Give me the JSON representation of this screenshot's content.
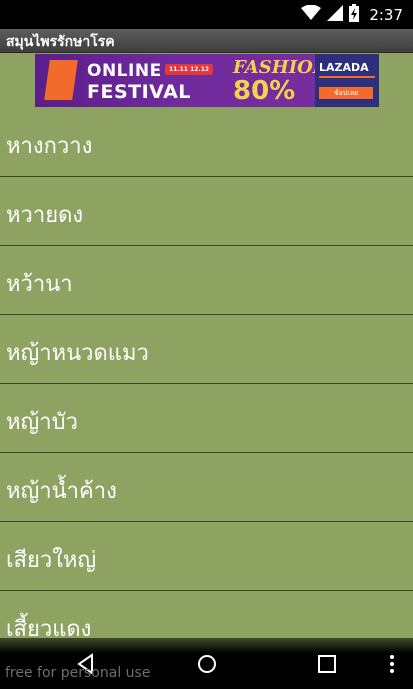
{
  "status_bar": {
    "time": "2:37",
    "icons": [
      "wifi-icon",
      "signal-icon",
      "battery-charging-icon"
    ]
  },
  "app": {
    "title": "สมุนไพรรักษาโรค"
  },
  "ad": {
    "line1": "ONLINE",
    "dates": "11.11 12.12",
    "line2": "FESTIVAL",
    "fashion": "FASHION",
    "discount": "80%",
    "brand": "LAZADA",
    "cta": "ช้อปเลย"
  },
  "herbs": [
    {
      "label": "หางกวาง"
    },
    {
      "label": "หวายดง"
    },
    {
      "label": "หว้านา"
    },
    {
      "label": "หญ้าหนวดแมว"
    },
    {
      "label": "หญ้าบัว"
    },
    {
      "label": "หญ้าน้ำค้าง"
    },
    {
      "label": "เสียวใหญ่"
    },
    {
      "label": "เสี้ยวแดง"
    }
  ],
  "watermark": "free for personal use",
  "colors": {
    "list_background": "#8ea362",
    "title_bar": "#4a4a4a",
    "divider": "#3b4328"
  }
}
